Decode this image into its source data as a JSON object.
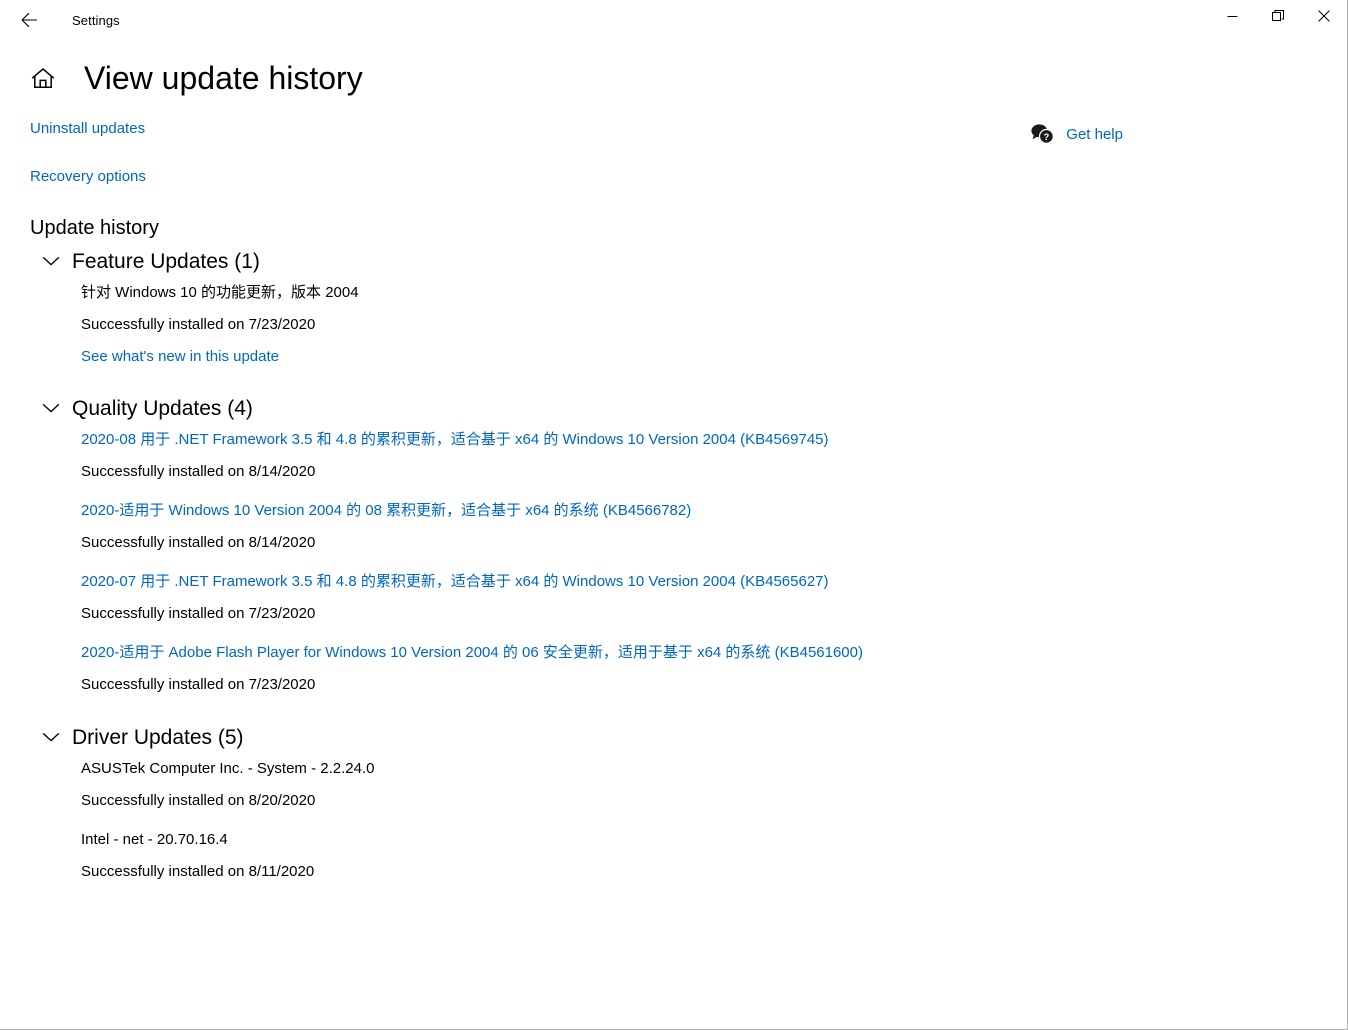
{
  "window": {
    "app_title": "Settings",
    "back_icon": "back-arrow-icon",
    "minimize_label": "—",
    "restore_label": "❐",
    "close_label": "✕"
  },
  "header": {
    "home_icon": "home-icon",
    "title": "View update history"
  },
  "links": {
    "uninstall_updates": "Uninstall updates",
    "recovery_options": "Recovery options"
  },
  "help": {
    "icon": "help-chat-question-icon",
    "label": "Get help"
  },
  "main": {
    "section_title": "Update history",
    "groups": [
      {
        "label": "Feature Updates (1)",
        "chevron": "chevron-down-icon",
        "entries": [
          {
            "title": "针对 Windows 10 的功能更新，版本 2004",
            "is_link": false,
            "status": "Successfully installed on 7/23/2020",
            "link": "See what's new in this update"
          }
        ]
      },
      {
        "label": "Quality Updates (4)",
        "chevron": "chevron-down-icon",
        "entries": [
          {
            "title": "2020-08 用于 .NET Framework 3.5 和 4.8 的累积更新，适合基于 x64 的 Windows 10 Version 2004 (KB4569745)",
            "is_link": true,
            "status": "Successfully installed on 8/14/2020"
          },
          {
            "title": "2020-适用于 Windows 10 Version 2004 的 08 累积更新，适合基于 x64 的系统 (KB4566782)",
            "is_link": true,
            "status": "Successfully installed on 8/14/2020"
          },
          {
            "title": "2020-07 用于 .NET Framework 3.5 和 4.8 的累积更新，适合基于 x64 的 Windows 10 Version 2004 (KB4565627)",
            "is_link": true,
            "status": "Successfully installed on 7/23/2020"
          },
          {
            "title": "2020-适用于 Adobe Flash Player for Windows 10 Version 2004 的 06 安全更新，适用于基于 x64 的系统 (KB4561600)",
            "is_link": true,
            "status": "Successfully installed on 7/23/2020"
          }
        ]
      },
      {
        "label": "Driver Updates (5)",
        "chevron": "chevron-down-icon",
        "entries": [
          {
            "title": "ASUSTek Computer Inc. - System - 2.2.24.0",
            "is_link": false,
            "status": "Successfully installed on 8/20/2020"
          },
          {
            "title": "Intel - net - 20.70.16.4",
            "is_link": false,
            "status": "Successfully installed on 8/11/2020"
          }
        ]
      }
    ]
  },
  "colors": {
    "link": "#0067c0",
    "text": "#000000",
    "background": "#ffffff"
  }
}
